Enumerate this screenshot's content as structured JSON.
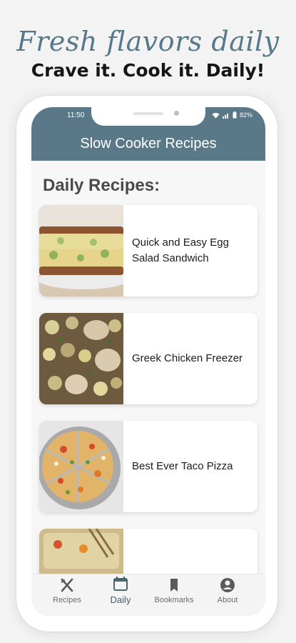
{
  "promo": {
    "title": "Fresh flavors daily",
    "subtitle": "Crave it. Cook it. Daily!"
  },
  "status": {
    "time": "11:50",
    "battery": "82%"
  },
  "app": {
    "title": "Slow Cooker Recipes"
  },
  "section": {
    "title": "Daily Recipes:"
  },
  "recipes": [
    {
      "title": "Quick and Easy Egg Salad Sandwich"
    },
    {
      "title": "Greek Chicken Freezer"
    },
    {
      "title": "Best Ever Taco Pizza"
    },
    {
      "title": ""
    }
  ],
  "nav": [
    {
      "label": "Recipes",
      "icon": "cutlery-icon"
    },
    {
      "label": "Daily",
      "icon": "calendar-icon"
    },
    {
      "label": "Bookmarks",
      "icon": "bookmark-icon"
    },
    {
      "label": "About",
      "icon": "account-circle-icon"
    }
  ],
  "colors": {
    "accent": "#5b7888",
    "promo_title": "#57798a",
    "background": "#f3f3f3"
  }
}
